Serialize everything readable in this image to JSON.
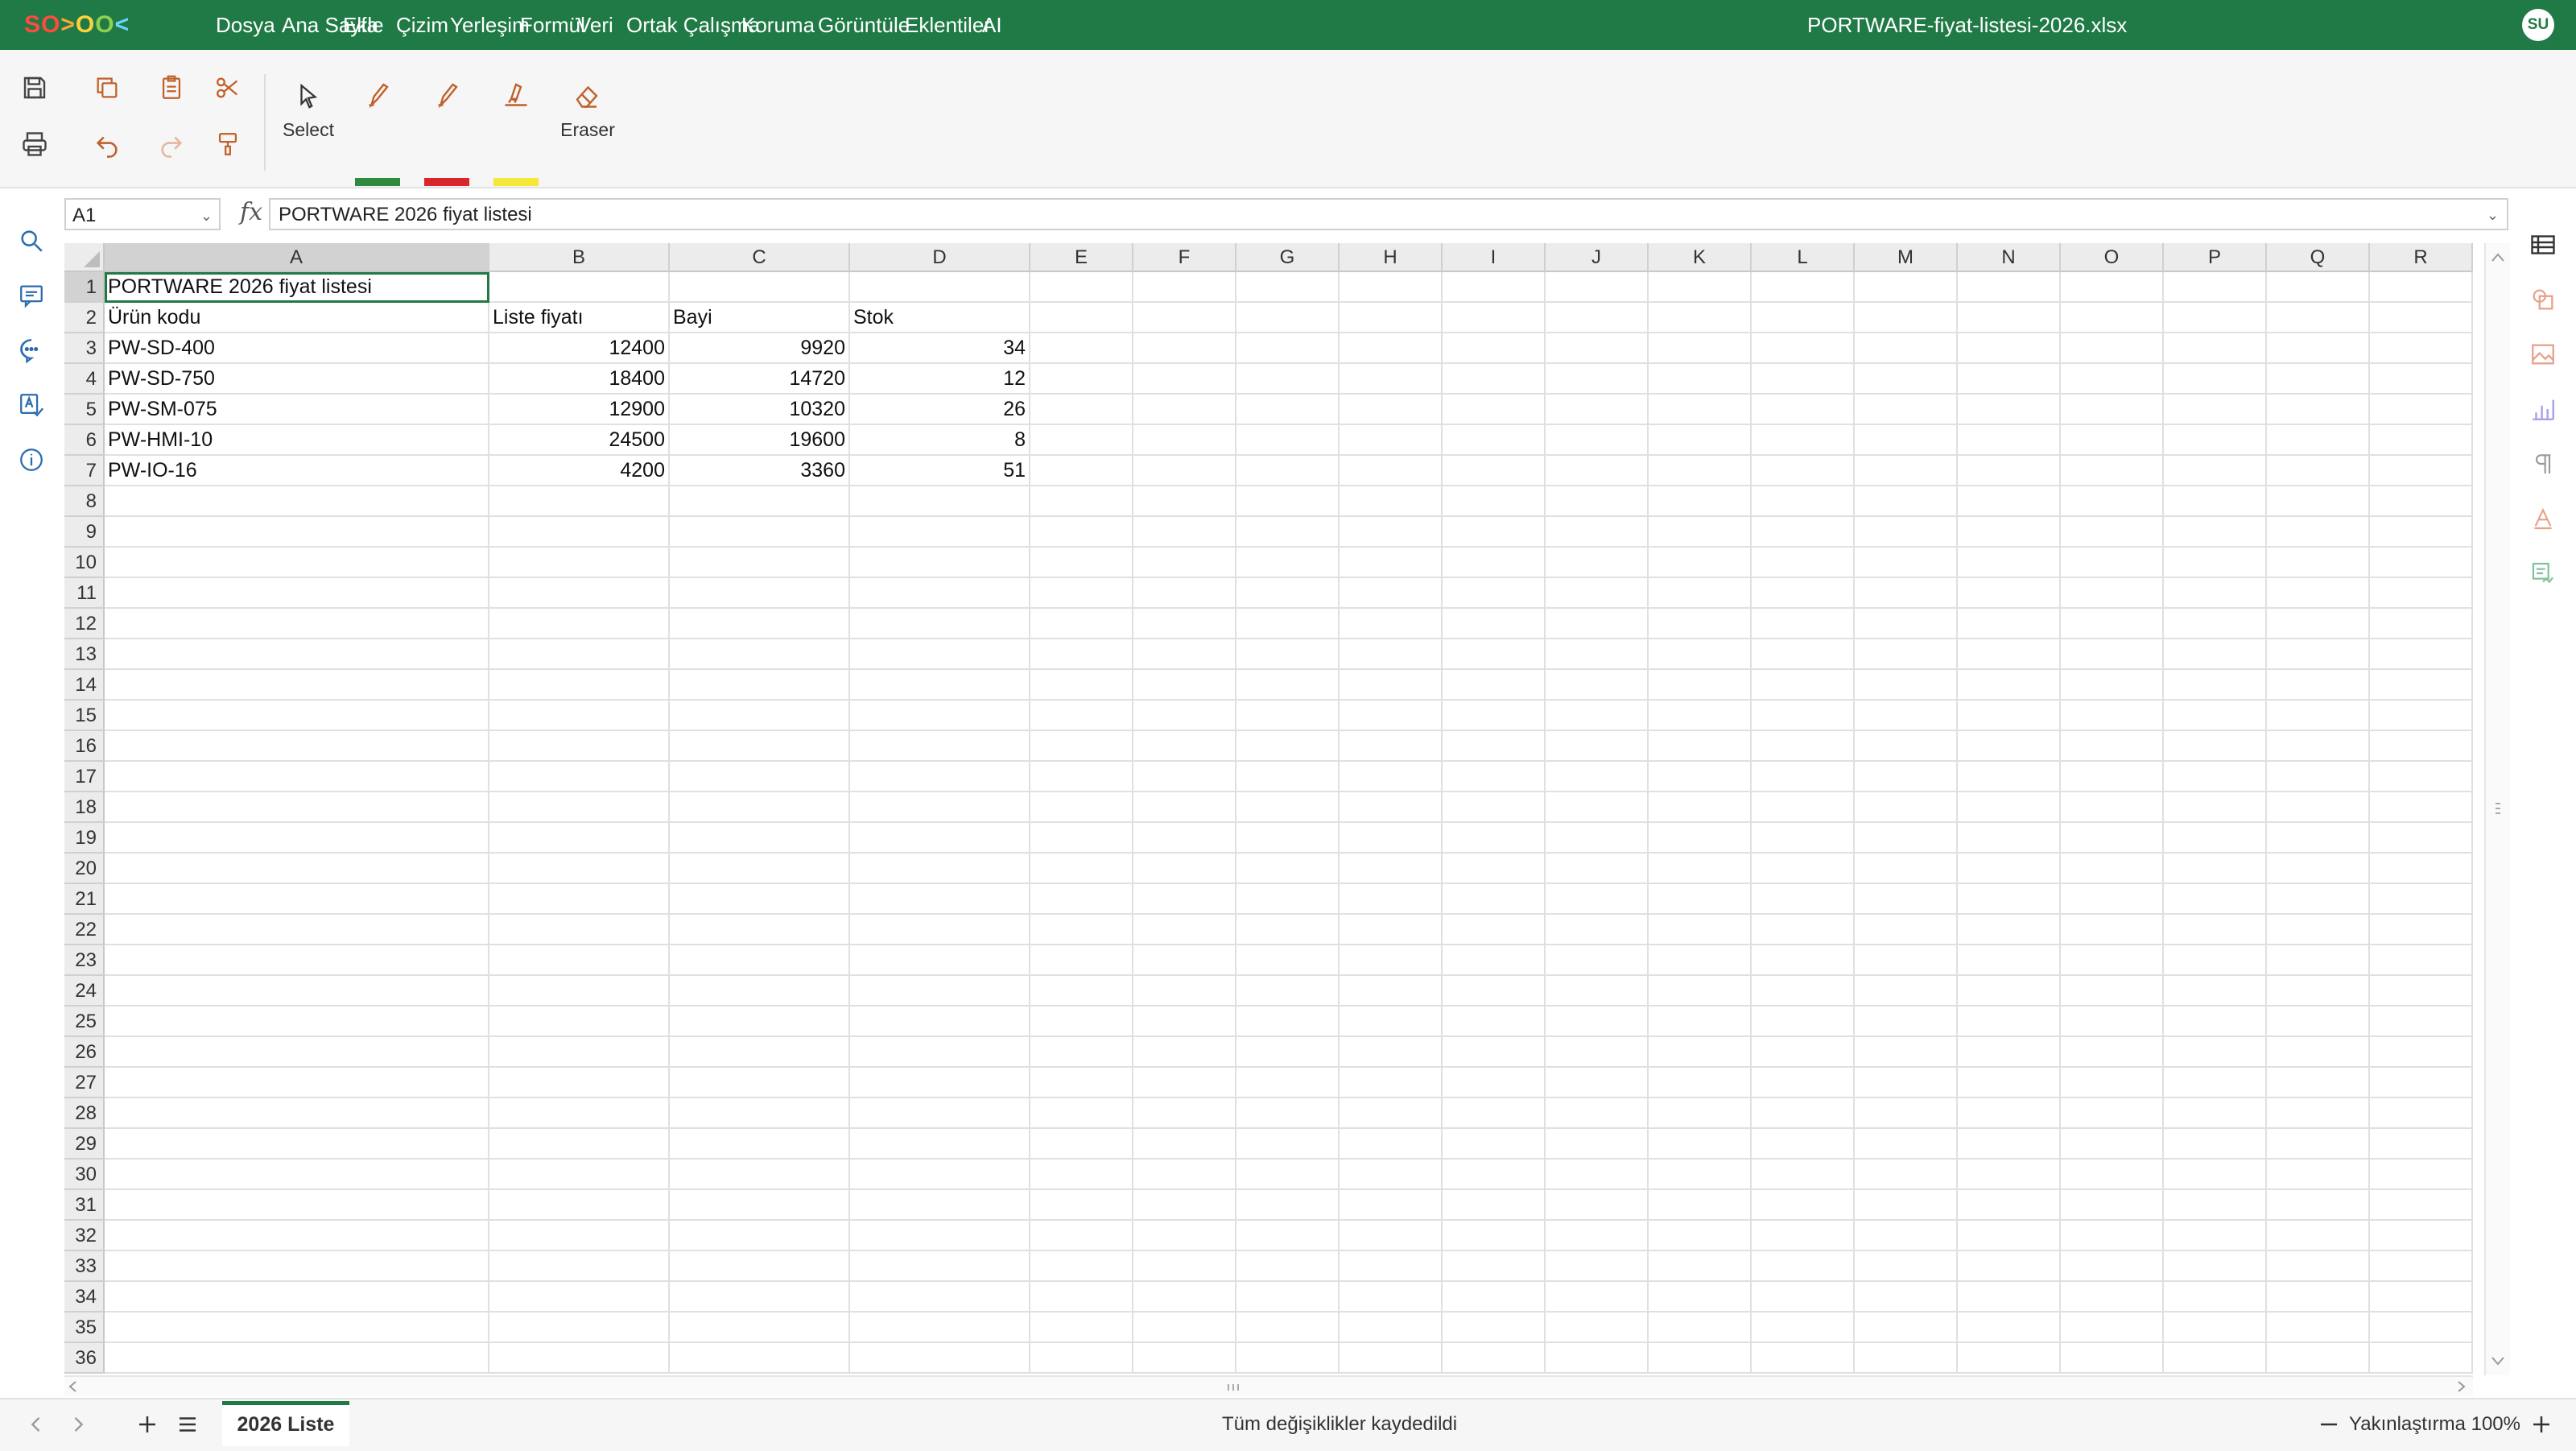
{
  "app": {
    "logo_parts": [
      "SO",
      ">",
      "O",
      "O",
      "<"
    ],
    "document_title": "PORTWARE-fiyat-listesi-2026.xlsx",
    "user_initials": "SU",
    "brand_color": "#1f7a45"
  },
  "menu": [
    "Dosya",
    "Ana Sayfa",
    "Ekle",
    "Çizim",
    "Yerleşim",
    "Formül",
    "Veri",
    "Ortak Çalışma",
    "Koruma",
    "Görüntüle",
    "Eklentiler",
    "AI"
  ],
  "toolbar": {
    "select_label": "Select",
    "eraser_label": "Eraser",
    "pen_colors": [
      "#2e8b3e",
      "#d9262c",
      "#f5e83a"
    ]
  },
  "formula_bar": {
    "cell_ref": "A1",
    "fx_symbol": "fx",
    "content": "PORTWARE 2026 fiyat listesi"
  },
  "sheet": {
    "columns": [
      "A",
      "B",
      "C",
      "D",
      "E",
      "F",
      "G",
      "H",
      "I",
      "J",
      "K",
      "L",
      "M",
      "N",
      "O",
      "P",
      "Q",
      "R"
    ],
    "selected_column": "A",
    "selected_row": 1,
    "row_count": 36,
    "rows": [
      [
        "PORTWARE 2026 fiyat listesi",
        "",
        "",
        ""
      ],
      [
        "Ürün kodu",
        "Liste fiyatı",
        "Bayi",
        "Stok"
      ],
      [
        "PW-SD-400",
        "12400",
        "9920",
        "34"
      ],
      [
        "PW-SD-750",
        "18400",
        "14720",
        "12"
      ],
      [
        "PW-SM-075",
        "12900",
        "10320",
        "26"
      ],
      [
        "PW-HMI-10",
        "24500",
        "19600",
        "8"
      ],
      [
        "PW-IO-16",
        "4200",
        "3360",
        "51"
      ]
    ]
  },
  "status": {
    "sheet_tab": "2026 Liste",
    "save_status": "Tüm değişiklikler kaydedildi",
    "zoom_label": "Yakınlaştırma 100%"
  }
}
